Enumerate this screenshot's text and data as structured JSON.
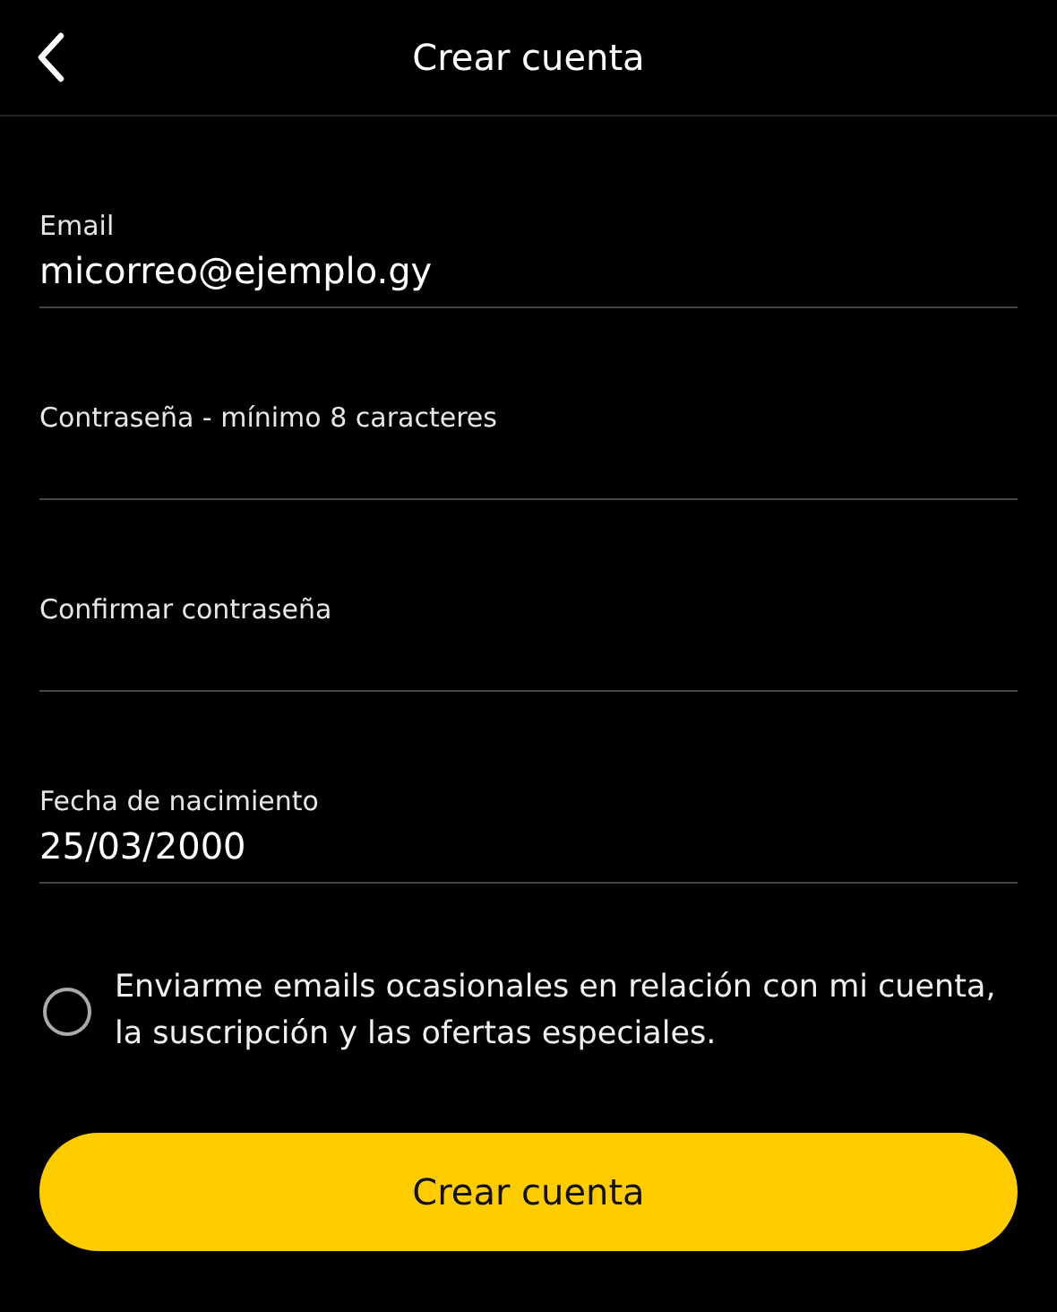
{
  "header": {
    "title": "Crear cuenta"
  },
  "fields": [
    {
      "label": "Email",
      "value": "micorreo@ejemplo.gy"
    },
    {
      "label": "Contraseña - mínimo 8 caracteres"
    },
    {
      "label": "Confirmar contraseña"
    },
    {
      "label": "Fecha de nacimiento",
      "value": "25/03/2000"
    }
  ],
  "consent": {
    "text": "Enviarme emails ocasionales en relación con mi cuenta, la suscripción y las ofertas especiales.",
    "checked": false
  },
  "submit": {
    "label": "Crear cuenta"
  }
}
